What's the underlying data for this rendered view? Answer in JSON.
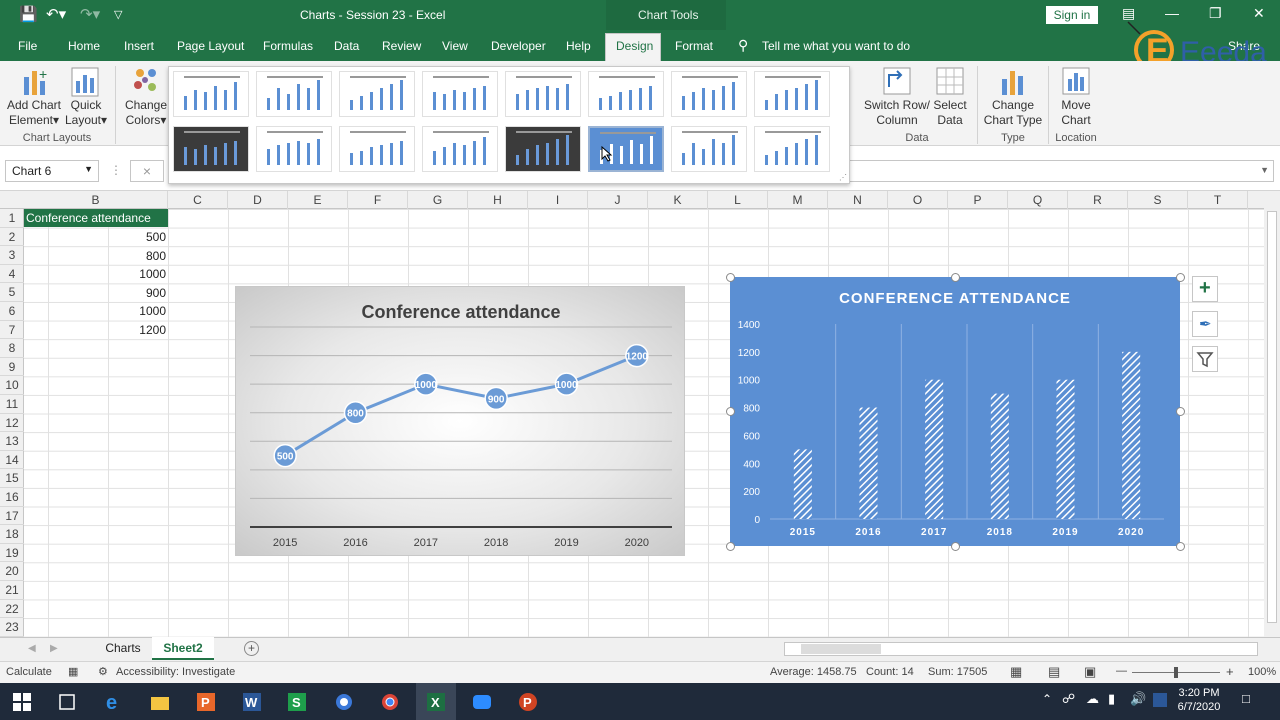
{
  "titlebar": {
    "doc_title": "Charts - Session 23  -  Excel",
    "chart_tools": "Chart Tools",
    "sign_in": "Sign in"
  },
  "tabs": [
    "File",
    "Home",
    "Insert",
    "Page Layout",
    "Formulas",
    "Data",
    "Review",
    "View",
    "Developer",
    "Help",
    "Design",
    "Format"
  ],
  "tell_me": "Tell me what you want to do",
  "share": "Share",
  "logo_text": "Eeeda",
  "ribbon": {
    "add_chart_element": [
      "Add Chart",
      "Element"
    ],
    "quick_layout": [
      "Quick",
      "Layout"
    ],
    "chart_layouts_group": "Chart Layouts",
    "change_colors": [
      "Change",
      "Colors"
    ],
    "switch_row_column": [
      "Switch Row/",
      "Column"
    ],
    "select_data": [
      "Select",
      "Data"
    ],
    "data_group": "Data",
    "change_chart_type": [
      "Change",
      "Chart Type"
    ],
    "type_group": "Type",
    "move_chart": [
      "Move",
      "Chart"
    ],
    "location_group": "Location"
  },
  "formula_bar": {
    "name_box": "Chart 6",
    "cancel": "×"
  },
  "columns": [
    "B",
    "C",
    "D",
    "E",
    "F",
    "G",
    "H",
    "I",
    "J",
    "K",
    "L",
    "M",
    "N",
    "O",
    "P",
    "Q",
    "R",
    "S",
    "T"
  ],
  "rows": [
    "1",
    "2",
    "3",
    "4",
    "5",
    "6",
    "7",
    "8",
    "9",
    "10",
    "11",
    "12",
    "13",
    "14",
    "15",
    "16",
    "17",
    "18",
    "19",
    "20",
    "21",
    "22",
    "23"
  ],
  "cells": {
    "b1": "Conference attendance",
    "values": [
      "500",
      "800",
      "1000",
      "900",
      "1000",
      "1200"
    ]
  },
  "chart_data": [
    {
      "type": "line",
      "title": "Conference attendance",
      "categories": [
        "2015",
        "2016",
        "2017",
        "2018",
        "2019",
        "2020"
      ],
      "values": [
        500,
        800,
        1000,
        900,
        1000,
        1200
      ],
      "data_labels": [
        "500",
        "800",
        "1000",
        "900",
        "1000",
        "1200"
      ],
      "ylim": [
        0,
        1400
      ],
      "grid": true,
      "color": "#6b9bd6"
    },
    {
      "type": "bar",
      "title": "CONFERENCE ATTENDANCE",
      "categories": [
        "2015",
        "2016",
        "2017",
        "2018",
        "2019",
        "2020"
      ],
      "values": [
        500,
        800,
        1000,
        900,
        1000,
        1200
      ],
      "y_ticks": [
        "0",
        "200",
        "400",
        "600",
        "800",
        "1000",
        "1200",
        "1400"
      ],
      "ylim": [
        0,
        1400
      ],
      "grid": true,
      "background": "#5b8fd3"
    }
  ],
  "sheets": [
    "Charts",
    "Sheet2"
  ],
  "active_sheet": "Sheet2",
  "status": {
    "mode": "Calculate",
    "accessibility": "Accessibility: Investigate",
    "average": "Average: 1458.75",
    "count": "Count: 14",
    "sum": "Sum: 17505",
    "zoom": "100%"
  },
  "taskbar": {
    "time": "3:20 PM",
    "date": "6/7/2020"
  }
}
